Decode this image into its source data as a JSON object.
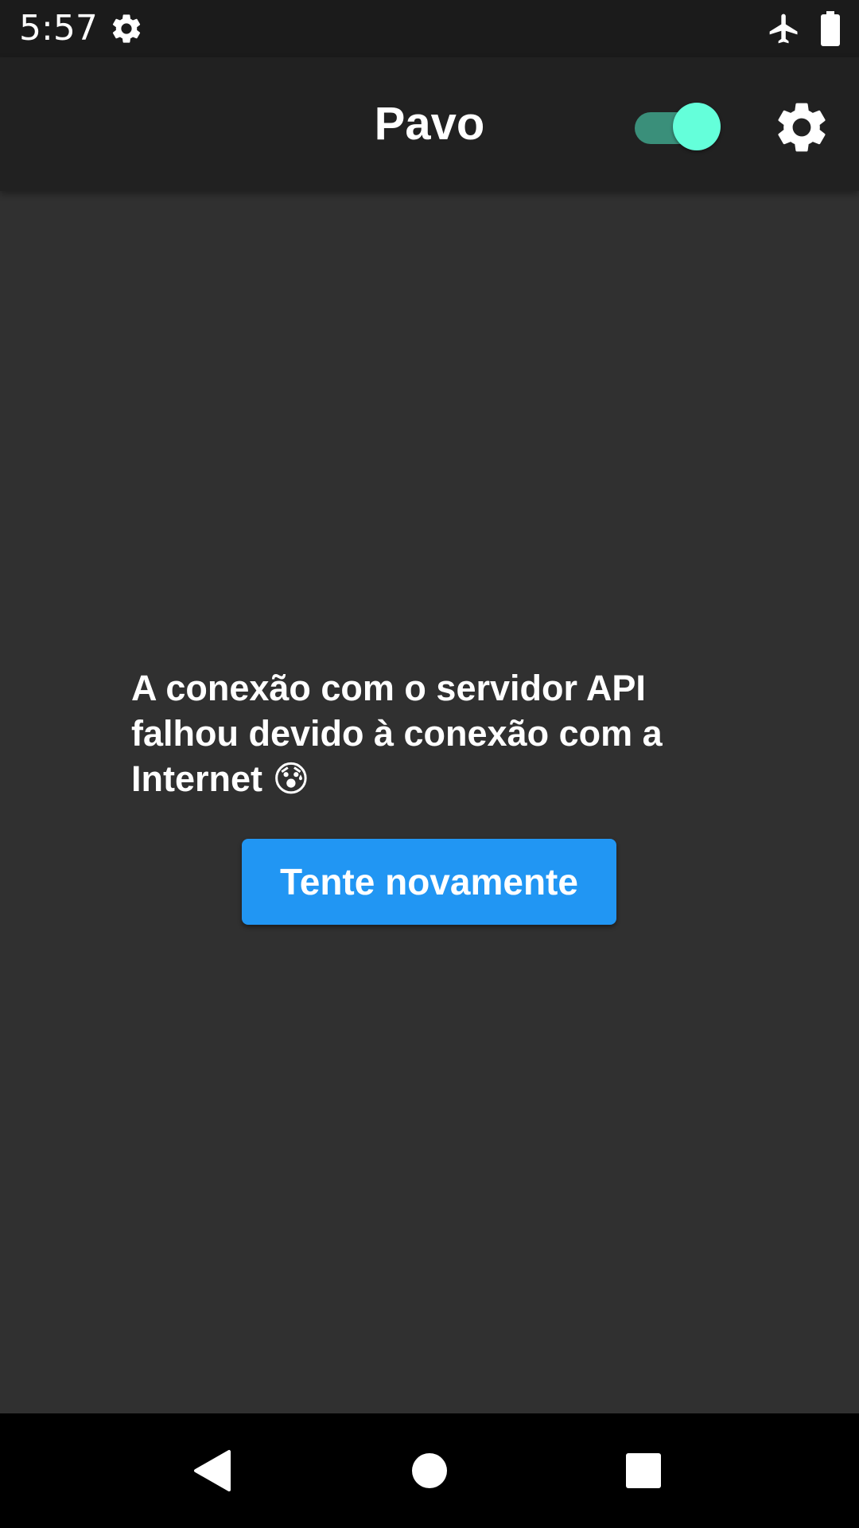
{
  "status_bar": {
    "time": "5:57",
    "icons": [
      "settings-icon",
      "airplane-icon",
      "battery-icon"
    ]
  },
  "app_bar": {
    "title": "Pavo",
    "toggle": {
      "state": "on",
      "track_color": "#3a8f7a",
      "thumb_color": "#64ffda"
    },
    "settings_icon": "gear-icon"
  },
  "main": {
    "message": "A conexão com o servidor API falhou devido à conexão com a Internet 😰",
    "retry_label": "Tente novamente",
    "retry_color": "#2196f3"
  },
  "nav_bar": {
    "icons": [
      "back-icon",
      "home-icon",
      "recents-icon"
    ]
  },
  "colors": {
    "background": "#303030",
    "app_bar": "#212121",
    "status_bar": "#1b1b1b"
  }
}
